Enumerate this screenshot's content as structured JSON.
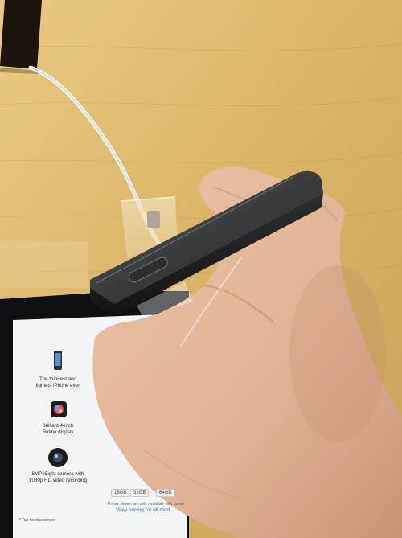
{
  "scene": {
    "description_tag": "photo",
    "colors": {
      "table": "#dcb66d",
      "phone": "#2b2c2e",
      "skin": "#e0b497",
      "ipad_screen": "#f3f4f6"
    }
  },
  "ipad": {
    "features": [
      {
        "icon": "phone-icon",
        "line1": "The thinnest and",
        "line2": "lightest iPhone ever"
      },
      {
        "icon": "retina-display-icon",
        "line1": "Brilliant 4-inch",
        "line2": "Retina display"
      },
      {
        "icon": "camera-icon",
        "line1": "8MP iSight camera with",
        "line2": "1080p HD video recording"
      }
    ],
    "capacity_options": [
      "16GB",
      "32GB",
      "64GB"
    ],
    "tiny_text": "Prices shown are only available with carrier",
    "view_link": "View pricing for all mod",
    "footnote": "* Tap for disclaimers"
  }
}
